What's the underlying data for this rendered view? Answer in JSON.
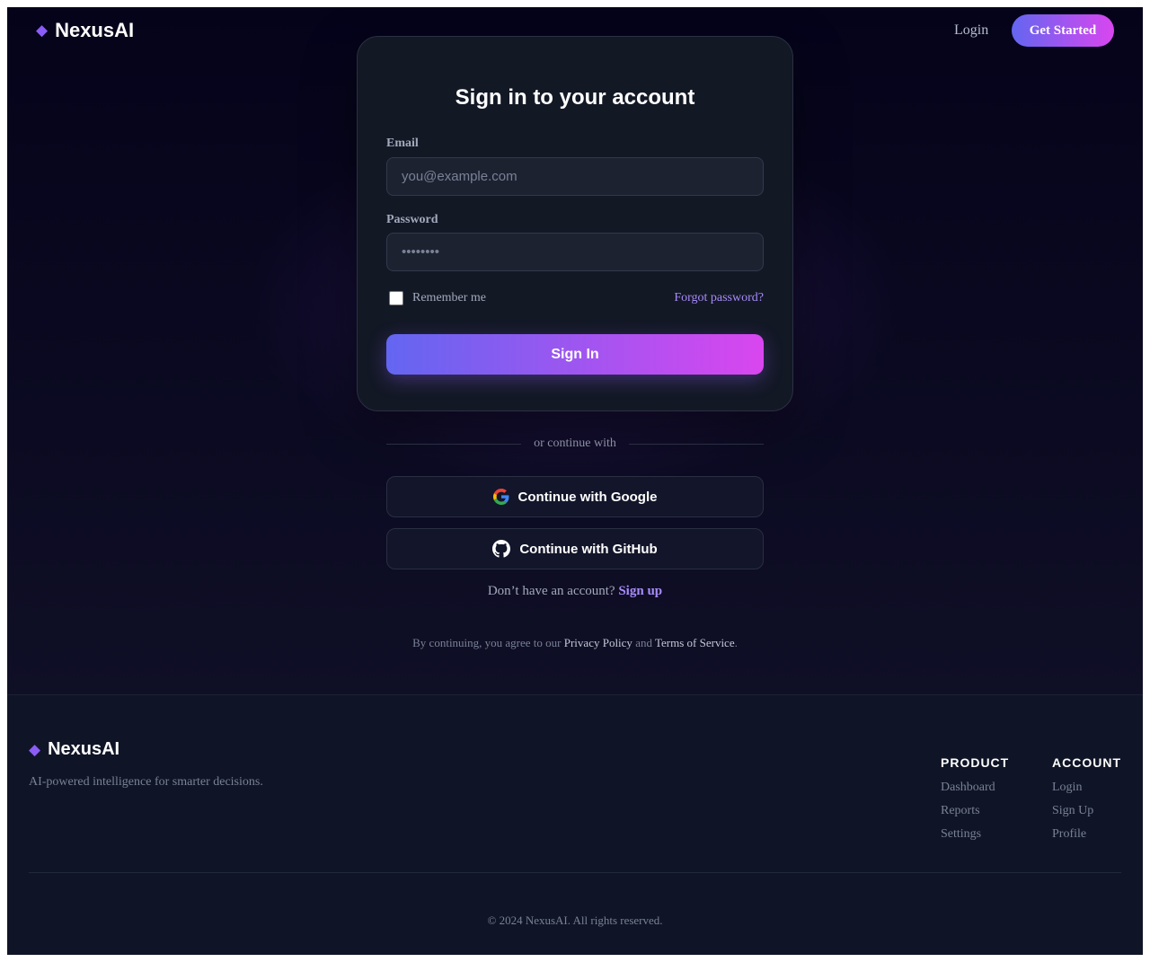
{
  "brand": {
    "name": "NexusAI",
    "logo_icon": "diamond-icon",
    "accent": "#8b5cf6"
  },
  "header": {
    "login_label": "Login",
    "cta_label": "Get Started"
  },
  "card": {
    "title": "Sign in to your account",
    "email_label": "Email",
    "email_placeholder": "you@example.com",
    "password_label": "Password",
    "password_placeholder": "••••••••",
    "remember_label": "Remember me",
    "forgot_label": "Forgot password?",
    "signin_label": "Sign In"
  },
  "divider_text": "or continue with",
  "social": {
    "google_label": "Continue with Google",
    "github_label": "Continue with GitHub"
  },
  "signup": {
    "prompt": "Don’t have an account?",
    "link": "Sign up"
  },
  "terms": {
    "prefix": "By continuing, you agree to our",
    "privacy": "Privacy Policy",
    "and": "and",
    "tos": "Terms of Service",
    "suffix": "."
  },
  "footer": {
    "brand_name": "NexusAI",
    "tagline": "AI-powered intelligence for smarter decisions.",
    "columns": [
      {
        "title": "PRODUCT",
        "links": [
          "Dashboard",
          "Reports",
          "Settings"
        ]
      },
      {
        "title": "ACCOUNT",
        "links": [
          "Login",
          "Sign Up",
          "Profile"
        ]
      }
    ],
    "copyright": "© 2024 NexusAI. All rights reserved."
  },
  "colors": {
    "gradient_start": "#6366f1",
    "gradient_end": "#d946ef",
    "link": "#a78bfa",
    "background": "#05031a"
  }
}
